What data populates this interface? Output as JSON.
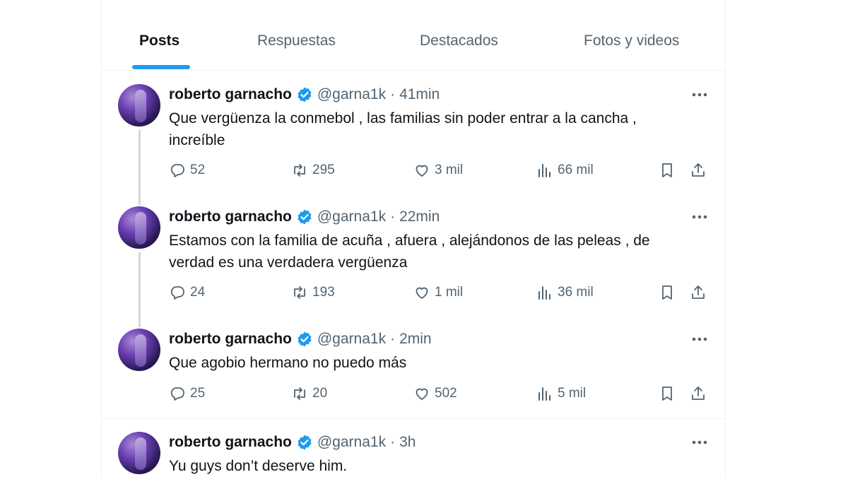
{
  "tabs": [
    {
      "label": "Posts"
    },
    {
      "label": "Respuestas"
    },
    {
      "label": "Destacados"
    },
    {
      "label": "Fotos y videos"
    }
  ],
  "tweets": [
    {
      "name": "roberto garnacho",
      "handle": "@garna1k",
      "dot": "·",
      "time": "41min",
      "text_lines": [
        "Que vergüenza la conmebol , las familias sin poder entrar a la cancha ,",
        "increíble"
      ],
      "replies": "52",
      "reposts": "295",
      "likes": "3 mil",
      "views": "66 mil"
    },
    {
      "name": "roberto garnacho",
      "handle": "@garna1k",
      "dot": "·",
      "time": "22min",
      "text_lines": [
        "Estamos con la familia de acuña , afuera , alejándonos de las peleas , de",
        "verdad es una verdadera vergüenza"
      ],
      "replies": "24",
      "reposts": "193",
      "likes": "1 mil",
      "views": "36 mil"
    },
    {
      "name": "roberto garnacho",
      "handle": "@garna1k",
      "dot": "·",
      "time": "2min",
      "text_lines": [
        "Que agobio hermano no puedo más"
      ],
      "replies": "25",
      "reposts": "20",
      "likes": "502",
      "views": "5 mil"
    },
    {
      "name": "roberto garnacho",
      "handle": "@garna1k",
      "dot": "·",
      "time": "3h",
      "text_lines": [
        "Yu guys don’t deserve him."
      ]
    }
  ],
  "colors": {
    "accent": "#1d9bf0",
    "secondary_text": "#536471",
    "primary_text": "#0f1419",
    "verified_badge": "#1d9bf0"
  },
  "icons": {
    "reply": "speech-bubble-icon",
    "repost": "repost-arrows-icon",
    "like": "heart-icon",
    "views": "bar-chart-icon",
    "bookmark": "bookmark-icon",
    "share": "share-upload-icon",
    "more": "more-dots-icon",
    "verified": "verified-badge-icon"
  }
}
